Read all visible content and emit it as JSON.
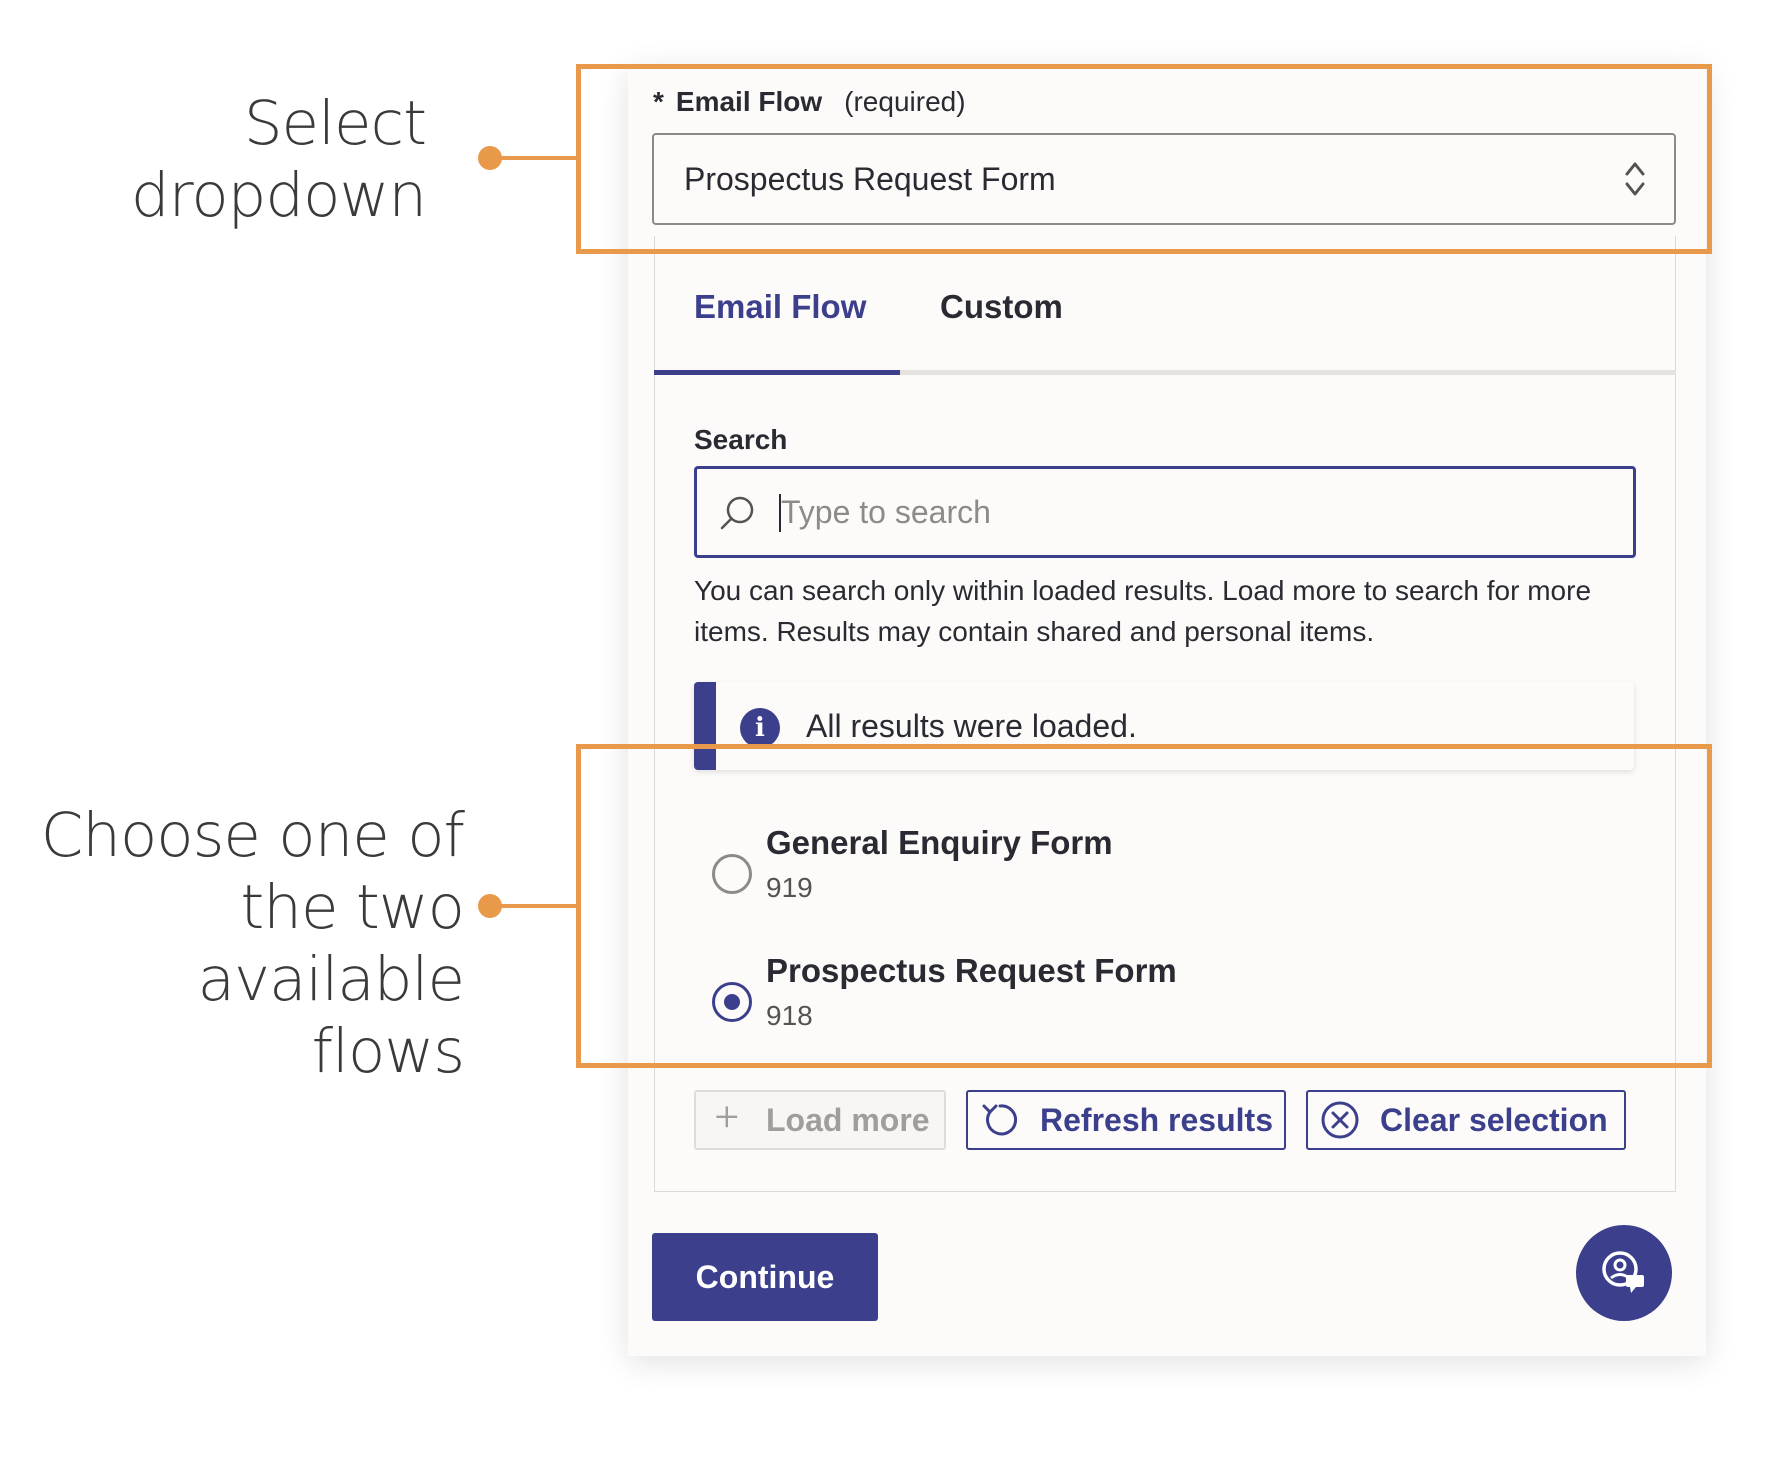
{
  "annotations": {
    "select_dropdown": [
      "Select",
      "dropdown"
    ],
    "choose_flow": [
      "Choose one of",
      "the two available",
      "flows"
    ],
    "accent_color": "#e8994a"
  },
  "field": {
    "required_marker": "*",
    "label": "Email Flow",
    "required_text": "(required)",
    "selected_value": "Prospectus Request Form"
  },
  "tabs": [
    {
      "label": "Email Flow",
      "active": true
    },
    {
      "label": "Custom",
      "active": false
    }
  ],
  "search": {
    "label": "Search",
    "placeholder": "Type to search",
    "help_text": "You can search only within loaded results. Load more to search for more items. Results may contain shared and personal items."
  },
  "info": {
    "icon": "info-icon",
    "message": "All results were loaded."
  },
  "options": [
    {
      "title": "General Enquiry Form",
      "id": "919",
      "selected": false
    },
    {
      "title": "Prospectus Request Form",
      "id": "918",
      "selected": true
    }
  ],
  "actions": {
    "load_more": "Load more",
    "refresh": "Refresh results",
    "clear": "Clear selection",
    "continue": "Continue"
  },
  "colors": {
    "primary": "#3b3f8c",
    "panel_bg": "#fcfbf9",
    "annotation": "#e8994a"
  }
}
